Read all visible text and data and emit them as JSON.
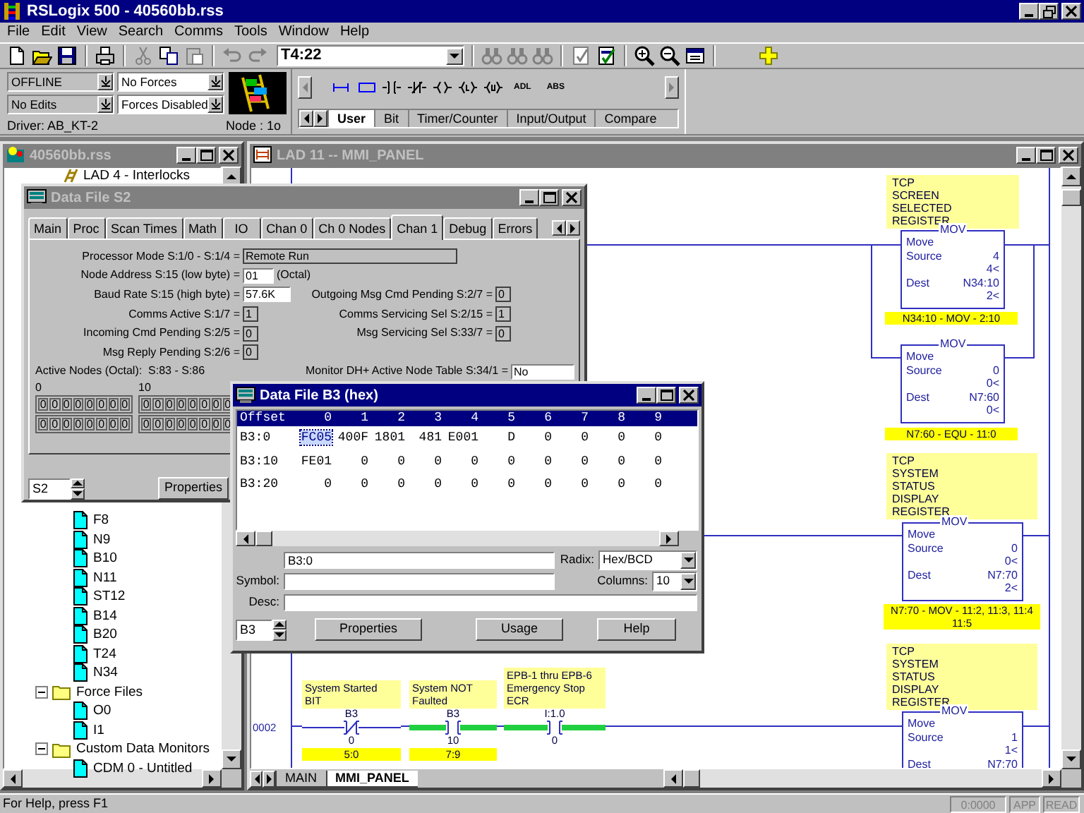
{
  "window": {
    "title": "RSLogix 500 - 40560bb.rss"
  },
  "menu": [
    "File",
    "Edit",
    "View",
    "Search",
    "Comms",
    "Tools",
    "Window",
    "Help"
  ],
  "toolbar": {
    "address": "T4:22"
  },
  "status_panel": {
    "mode": "OFFLINE",
    "forces": "No Forces",
    "edits": "No Edits",
    "force_state": "Forces Disabled",
    "driver": "Driver: AB_KT-2",
    "node": "Node : 1o"
  },
  "instruction_palette": {
    "buttons": [
      {
        "kind": "rung"
      },
      {
        "kind": "branch"
      },
      {
        "kind": "xic"
      },
      {
        "kind": "xio"
      },
      {
        "kind": "ote"
      },
      {
        "kind": "otl"
      },
      {
        "kind": "otu"
      },
      {
        "kind": "text",
        "label": "ADL"
      },
      {
        "kind": "text",
        "label": "ABS"
      }
    ],
    "tabs": [
      {
        "label": "User",
        "selected": true
      },
      {
        "label": "Bit",
        "selected": false
      },
      {
        "label": "Timer/Counter",
        "selected": false
      },
      {
        "label": "Input/Output",
        "selected": false
      },
      {
        "label": "Compare",
        "selected": false
      }
    ]
  },
  "project_window": {
    "title": "40560bb.rss",
    "top_items": [
      {
        "label": "LAD 4 - Interlocks",
        "kind": "ladder"
      }
    ],
    "items": [
      {
        "label": "F8",
        "kind": "file"
      },
      {
        "label": "N9",
        "kind": "file"
      },
      {
        "label": "B10",
        "kind": "file"
      },
      {
        "label": "N11",
        "kind": "file"
      },
      {
        "label": "ST12",
        "kind": "file"
      },
      {
        "label": "B14",
        "kind": "file"
      },
      {
        "label": "B20",
        "kind": "file"
      },
      {
        "label": "T24",
        "kind": "file"
      },
      {
        "label": "N34",
        "kind": "file"
      },
      {
        "label": "Force Files",
        "kind": "folder",
        "expanded": true,
        "children": [
          {
            "label": "O0",
            "kind": "file"
          },
          {
            "label": "I1",
            "kind": "file"
          }
        ]
      },
      {
        "label": "Custom Data Monitors",
        "kind": "folder",
        "expanded": true,
        "children": [
          {
            "label": "CDM 0 - Untitled",
            "kind": "file"
          }
        ]
      }
    ]
  },
  "lad_window": {
    "title": "LAD 11 -- MMI_PANEL",
    "outputs": [
      {
        "kind": "comment",
        "text": "TCP\nSCREEN\nSELECTED\nREGISTER"
      },
      {
        "kind": "mov",
        "mnemonic": "MOV",
        "name": "Move",
        "source_label": "Source",
        "source": "4",
        "source_value": "4<",
        "dest_label": "Dest",
        "dest": "N34:10",
        "dest_value": "2<"
      },
      {
        "kind": "xref",
        "text": "N34:10 - MOV - 2:10"
      },
      {
        "kind": "mov",
        "mnemonic": "MOV",
        "name": "Move",
        "source_label": "Source",
        "source": "0",
        "source_value": "0<",
        "dest_label": "Dest",
        "dest": "N7:60",
        "dest_value": "0<"
      },
      {
        "kind": "xref",
        "text": "N7:60 - EQU - 11:0"
      },
      {
        "kind": "comment",
        "text": "TCP\nSYSTEM\nSTATUS\nDISPLAY\nREGISTER"
      },
      {
        "kind": "mov",
        "mnemonic": "MOV",
        "name": "Move",
        "source_label": "Source",
        "source": "0",
        "source_value": "0<",
        "dest_label": "Dest",
        "dest": "N7:70",
        "dest_value": "2<"
      },
      {
        "kind": "xref",
        "text": "N7:70 - MOV - 11:2, 11:3, 11:4\n11:5"
      },
      {
        "kind": "comment",
        "text": "TCP\nSYSTEM\nSTATUS\nDISPLAY\nREGISTER"
      },
      {
        "kind": "mov",
        "mnemonic": "MOV",
        "name": "Move",
        "source_label": "Source",
        "source": "1",
        "source_value": "1<",
        "dest_label": "Dest",
        "dest": "N7:70"
      }
    ],
    "rung": {
      "number": "0002",
      "contacts": [
        {
          "kind": "xio",
          "comment": "System Started\nBIT",
          "address": "B3",
          "bit": "0",
          "xref": "5:0",
          "energized": false
        },
        {
          "kind": "xic",
          "comment": "System NOT\nFaulted",
          "address": "B3",
          "bit": "10",
          "xref": "7:9",
          "energized": true
        },
        {
          "kind": "xic",
          "comment": "EPB-1 thru EPB-6\nEmergency Stop\nECR",
          "address": "I:1.0",
          "bit": "0",
          "energized": true
        }
      ]
    },
    "sheets": [
      {
        "label": "MAIN",
        "selected": false
      },
      {
        "label": "MMI_PANEL",
        "selected": true
      }
    ]
  },
  "s2_window": {
    "title": "Data File S2",
    "tabs": [
      {
        "label": "Main",
        "selected": false
      },
      {
        "label": "Proc",
        "selected": false
      },
      {
        "label": "Scan Times",
        "selected": false
      },
      {
        "label": "Math",
        "selected": false
      },
      {
        "label": "IO",
        "selected": false
      },
      {
        "label": "Chan 0",
        "selected": false
      },
      {
        "label": "Ch 0 Nodes",
        "selected": false
      },
      {
        "label": "Chan 1",
        "selected": true
      },
      {
        "label": "Debug",
        "selected": false
      },
      {
        "label": "Errors",
        "selected": false
      }
    ],
    "fields": [
      {
        "label": "Processor Mode S:1/0 - S:1/4 =",
        "value": "Remote Run",
        "editable": false
      },
      {
        "label": "Node Address S:15 (low byte) =",
        "value": "01",
        "editable": true,
        "suffix": "(Octal)"
      },
      {
        "label": "Baud Rate S:15 (high byte) =",
        "value": "57.6K",
        "editable": true
      },
      {
        "label": "Comms Active S:1/7 =",
        "value": "1",
        "editable": false
      },
      {
        "label": "Incoming Cmd Pending S:2/5 =",
        "value": "0",
        "editable": false
      },
      {
        "label": "Msg Reply Pending S:2/6 =",
        "value": "0",
        "editable": false
      }
    ],
    "right_fields": [
      {
        "label": "Outgoing Msg Cmd Pending S:2/7 =",
        "value": "0",
        "editable": false
      },
      {
        "label": "Comms Servicing Sel S:2/15 =",
        "value": "1",
        "editable": false
      },
      {
        "label": "Msg Servicing Sel S:33/7 =",
        "value": "0",
        "editable": false
      },
      {
        "label": "Monitor DH+ Active Node Table S:34/1 =",
        "value": "No",
        "editable": true
      }
    ],
    "active_nodes": {
      "label": "Active Nodes (Octal):  S:83 - S:86",
      "groups": [
        {
          "heading": "0",
          "rows": [
            [
              "0",
              "0",
              "0",
              "0",
              "0",
              "0",
              "0",
              "0"
            ],
            [
              "0",
              "0",
              "0",
              "0",
              "0",
              "0",
              "0",
              "0"
            ]
          ]
        },
        {
          "heading": "10",
          "rows": [
            [
              "0",
              "0",
              "0",
              "0",
              "0",
              "0",
              "0",
              "0"
            ],
            [
              "0",
              "0",
              "0",
              "0",
              "0",
              "0",
              "0",
              "0"
            ]
          ]
        }
      ]
    },
    "file": "S2",
    "button": "Properties"
  },
  "b3_window": {
    "title": "Data File B3 (hex)",
    "columns": [
      "Offset",
      "0",
      "1",
      "2",
      "3",
      "4",
      "5",
      "6",
      "7",
      "8",
      "9"
    ],
    "rows": [
      {
        "cells": [
          {
            "text": "B3:0",
            "selected": false
          },
          {
            "text": "FC05",
            "selected": true
          },
          {
            "text": "400F",
            "selected": false
          },
          {
            "text": "1801",
            "selected": false
          },
          {
            "text": "481",
            "selected": false
          },
          {
            "text": "E001",
            "selected": false
          },
          {
            "text": "D",
            "selected": false
          },
          {
            "text": "0",
            "selected": false
          },
          {
            "text": "0",
            "selected": false
          },
          {
            "text": "0",
            "selected": false
          },
          {
            "text": "0",
            "selected": false
          }
        ]
      },
      {
        "cells": [
          {
            "text": "B3:10",
            "selected": false
          },
          {
            "text": "FE01",
            "selected": false
          },
          {
            "text": "0",
            "selected": false
          },
          {
            "text": "0",
            "selected": false
          },
          {
            "text": "0",
            "selected": false
          },
          {
            "text": "0",
            "selected": false
          },
          {
            "text": "0",
            "selected": false
          },
          {
            "text": "0",
            "selected": false
          },
          {
            "text": "0",
            "selected": false
          },
          {
            "text": "0",
            "selected": false
          },
          {
            "text": "0",
            "selected": false
          }
        ]
      },
      {
        "cells": [
          {
            "text": "B3:20",
            "selected": false
          },
          {
            "text": "0",
            "selected": false
          },
          {
            "text": "0",
            "selected": false
          },
          {
            "text": "0",
            "selected": false
          },
          {
            "text": "0",
            "selected": false
          },
          {
            "text": "0",
            "selected": false
          },
          {
            "text": "0",
            "selected": false
          },
          {
            "text": "0",
            "selected": false
          },
          {
            "text": "0",
            "selected": false
          },
          {
            "text": "0",
            "selected": false
          },
          {
            "text": "0",
            "selected": false
          }
        ]
      }
    ],
    "address": "B3:0",
    "radix_label": "Radix:",
    "radix": "Hex/BCD",
    "symbol_label": "Symbol:",
    "columns_label": "Columns:",
    "column_count": "10",
    "desc_label": "Desc:",
    "file": "B3",
    "buttons": [
      "Properties",
      "Usage",
      "Help"
    ]
  },
  "status_bar": {
    "help": "For Help, press F1",
    "position": "0:0000",
    "mode": "APP",
    "state": "READ"
  }
}
